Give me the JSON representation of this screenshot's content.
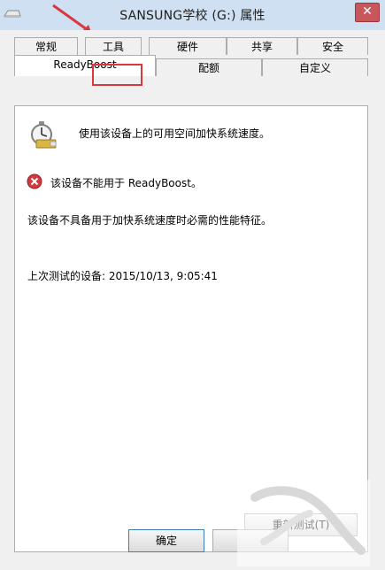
{
  "window": {
    "title": "SANSUNG学校 (G:) 属性",
    "close_glyph": "✕"
  },
  "tabs_row1": [
    {
      "label": "常规"
    },
    {
      "label": "工具"
    },
    {
      "label": "硬件"
    },
    {
      "label": "共享"
    },
    {
      "label": "安全"
    }
  ],
  "tabs_row2": [
    {
      "label": "ReadyBoost",
      "active": true
    },
    {
      "label": "配额"
    },
    {
      "label": "自定义"
    }
  ],
  "readyboost": {
    "description": "使用该设备上的可用空间加快系统速度。",
    "error_message": "该设备不能用于 ReadyBoost。",
    "reason": "该设备不具备用于加快系统速度时必需的性能特征。",
    "last_test": "上次测试的设备: 2015/10/13, 9:05:41"
  },
  "buttons": {
    "retest": "重新测试(T)",
    "ok": "确定",
    "cancel": ""
  },
  "icons": {
    "window_icon": "drive-icon",
    "readyboost_icon": "readyboost-stopwatch-icon",
    "error_icon": "error-x-icon"
  },
  "colors": {
    "titlebar": "#cfe0f2",
    "close_button": "#c7575a",
    "highlight": "#d9383e"
  }
}
